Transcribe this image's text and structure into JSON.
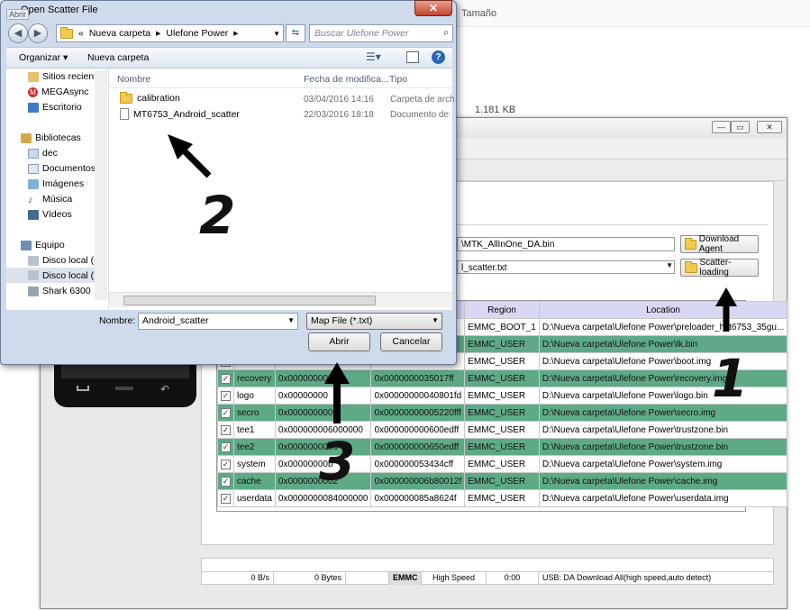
{
  "background": {
    "col_size": "Tamaño",
    "file_size": "1.181 KB"
  },
  "dialog": {
    "title": "Open Scatter File",
    "caption_tooltip": "Abrir",
    "address": {
      "overflow": "«",
      "parts": [
        "Nueva carpeta",
        "Ulefone Power"
      ]
    },
    "search_placeholder": "Buscar Ulefone Power",
    "toolbar": {
      "organize": "Organizar ▾",
      "new_folder": "Nueva carpeta"
    },
    "nav": {
      "items": [
        "Sitios reciente",
        "MEGAsync",
        "Escritorio"
      ],
      "libraries": "Bibliotecas",
      "library_items": [
        "dec",
        "Documentos",
        "Imágenes",
        "Música",
        "Vídeos"
      ],
      "computer": "Equipo",
      "computer_items": [
        "Disco local (C",
        "Disco local (D",
        "Shark 6300"
      ]
    },
    "columns": {
      "name": "Nombre",
      "date": "Fecha de modifica...",
      "type": "Tipo"
    },
    "files": [
      {
        "name": "calibration",
        "date": "03/04/2016 14:16",
        "type": "Carpeta de arch"
      },
      {
        "name": "MT6753_Android_scatter",
        "date": "22/03/2016 18:18",
        "type": "Documento de"
      }
    ],
    "filename_label": "Nombre:",
    "filename_value": "Android_scatter",
    "filter": "Map File (*.txt)",
    "open": "Abrir",
    "cancel": "Cancelar"
  },
  "flash": {
    "da_field": "\\MTK_AllInOne_DA.bin",
    "scatter_field": "l_scatter.txt",
    "download_agent": "Download Agent",
    "scatter_loading": "Scatter-loading",
    "table_headers": [
      "",
      "",
      "",
      "",
      "Region",
      "Location"
    ],
    "rows": [
      {
        "name": "",
        "begin": "",
        "end": "",
        "region": "EMMC_BOOT_1",
        "location": "D:\\Nueva carpeta\\Ulefone Power\\preloader_hct6753_35gu...",
        "green": false
      },
      {
        "name": "",
        "begin": "",
        "end": "",
        "region": "EMMC_USER",
        "location": "D:\\Nueva carpeta\\Ulefone Power\\lk.bin",
        "green": true
      },
      {
        "name": "",
        "begin": "",
        "end": "",
        "region": "EMMC_USER",
        "location": "D:\\Nueva carpeta\\Ulefone Power\\boot.img",
        "green": false
      },
      {
        "name": "recovery",
        "begin": "0x0000000002",
        "end": "0x0000000035017ff",
        "region": "EMMC_USER",
        "location": "D:\\Nueva carpeta\\Ulefone Power\\recovery.img",
        "green": true
      },
      {
        "name": "logo",
        "begin": "0x00000000",
        "end": "0x00000000040801fd",
        "region": "EMMC_USER",
        "location": "D:\\Nueva carpeta\\Ulefone Power\\logo.bin",
        "green": false
      },
      {
        "name": "secro",
        "begin": "0x0000000005",
        "end": "0x00000000005220fff",
        "region": "EMMC_USER",
        "location": "D:\\Nueva carpeta\\Ulefone Power\\secro.img",
        "green": true
      },
      {
        "name": "tee1",
        "begin": "0x000000006000000",
        "end": "0x000000000600edff",
        "region": "EMMC_USER",
        "location": "D:\\Nueva carpeta\\Ulefone Power\\trustzone.bin",
        "green": false
      },
      {
        "name": "tee2",
        "begin": "0x0000000006",
        "end": "0x000000000650edff",
        "region": "EMMC_USER",
        "location": "D:\\Nueva carpeta\\Ulefone Power\\trustzone.bin",
        "green": true
      },
      {
        "name": "system",
        "begin": "0x00000000b",
        "end": "0x000000053434cff",
        "region": "EMMC_USER",
        "location": "D:\\Nueva carpeta\\Ulefone Power\\system.img",
        "green": false
      },
      {
        "name": "cache",
        "begin": "0x0000000002",
        "end": "0x000000006b80012f",
        "region": "EMMC_USER",
        "location": "D:\\Nueva carpeta\\Ulefone Power\\cache.img",
        "green": true
      },
      {
        "name": "userdata",
        "begin": "0x0000000084000000",
        "end": "0x000000085a8624f",
        "region": "EMMC_USER",
        "location": "D:\\Nueva carpeta\\Ulefone Power\\userdata.img",
        "green": false
      }
    ],
    "status": [
      "0 B/s",
      "0 Bytes",
      "",
      "EMMC",
      "High Speed",
      "0:00",
      "USB: DA Download All(high speed,auto detect)"
    ]
  },
  "annotations": {
    "one": "1",
    "two": "2",
    "three": "3"
  },
  "colors": {
    "row_green": "#5eaa86",
    "header_lavender": "#d8d8f5",
    "dialog_frame": "#cfdbeb",
    "close_red": "#c7412a"
  }
}
